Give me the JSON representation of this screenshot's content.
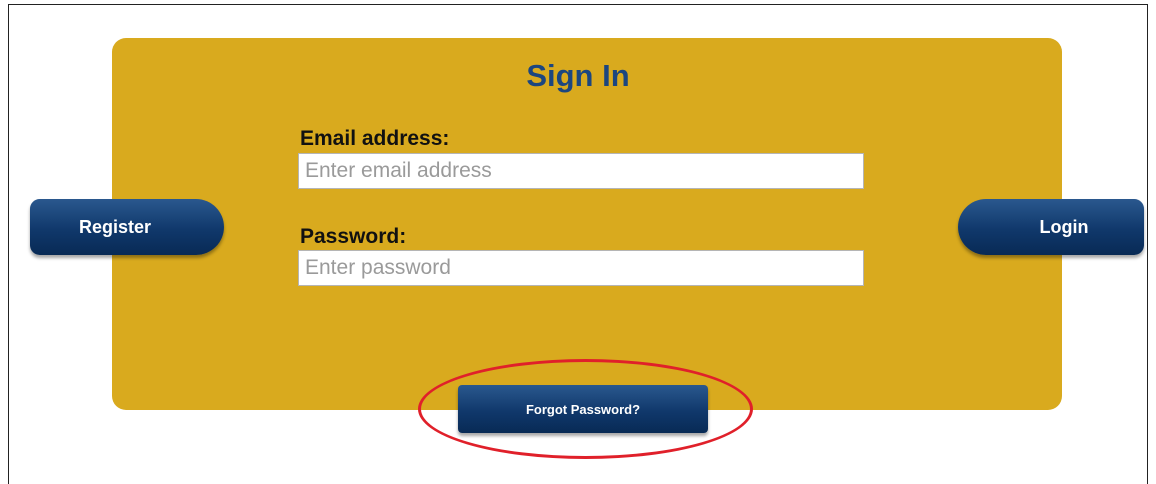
{
  "form": {
    "title": "Sign In",
    "email": {
      "label": "Email address:",
      "placeholder": "Enter email address",
      "value": ""
    },
    "password": {
      "label": "Password:",
      "placeholder": "Enter password",
      "value": ""
    }
  },
  "buttons": {
    "register": "Register",
    "login": "Login",
    "forgot": "Forgot Password?"
  },
  "colors": {
    "panel": "#d9aa1e",
    "title": "#1c467f",
    "button": "#10386b",
    "highlight": "#e0202a"
  }
}
